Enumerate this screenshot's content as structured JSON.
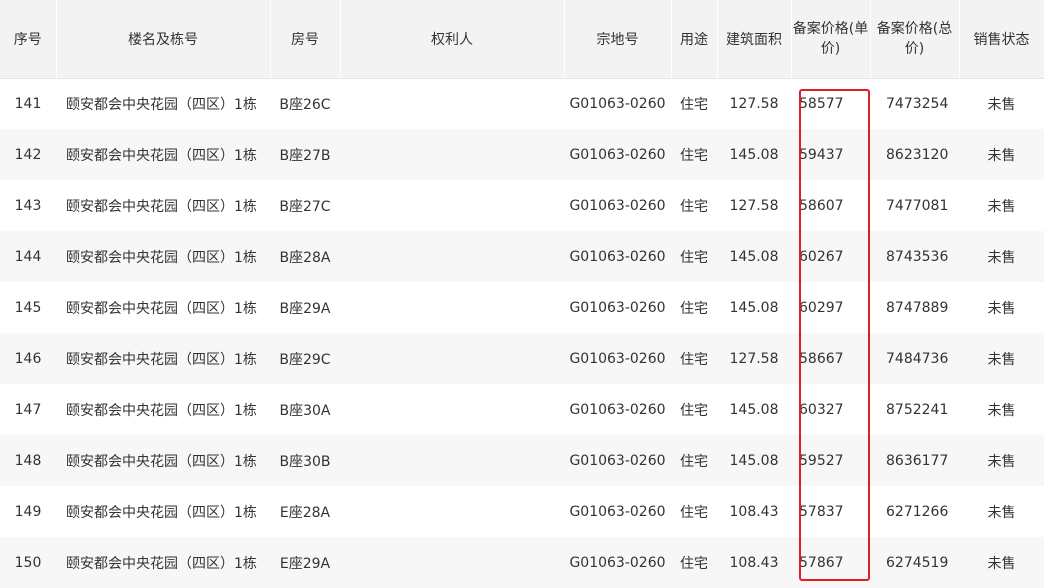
{
  "table": {
    "headers": {
      "index": "序号",
      "building": "楼名及栋号",
      "room": "房号",
      "owner": "权利人",
      "parcel": "宗地号",
      "usage": "用途",
      "area": "建筑面积",
      "unit_price": "备案价格(单价)",
      "total_price": "备案价格(总价)",
      "status": "销售状态"
    },
    "rows": [
      {
        "index": "141",
        "building": "颐安都会中央花园（四区）1栋",
        "room": "B座26C",
        "owner": "",
        "parcel": "G01063-0260",
        "usage": "住宅",
        "area": "127.58",
        "unit_price": "58577",
        "total_price": "7473254",
        "status": "未售"
      },
      {
        "index": "142",
        "building": "颐安都会中央花园（四区）1栋",
        "room": "B座27B",
        "owner": "",
        "parcel": "G01063-0260",
        "usage": "住宅",
        "area": "145.08",
        "unit_price": "59437",
        "total_price": "8623120",
        "status": "未售"
      },
      {
        "index": "143",
        "building": "颐安都会中央花园（四区）1栋",
        "room": "B座27C",
        "owner": "",
        "parcel": "G01063-0260",
        "usage": "住宅",
        "area": "127.58",
        "unit_price": "58607",
        "total_price": "7477081",
        "status": "未售"
      },
      {
        "index": "144",
        "building": "颐安都会中央花园（四区）1栋",
        "room": "B座28A",
        "owner": "",
        "parcel": "G01063-0260",
        "usage": "住宅",
        "area": "145.08",
        "unit_price": "60267",
        "total_price": "8743536",
        "status": "未售"
      },
      {
        "index": "145",
        "building": "颐安都会中央花园（四区）1栋",
        "room": "B座29A",
        "owner": "",
        "parcel": "G01063-0260",
        "usage": "住宅",
        "area": "145.08",
        "unit_price": "60297",
        "total_price": "8747889",
        "status": "未售"
      },
      {
        "index": "146",
        "building": "颐安都会中央花园（四区）1栋",
        "room": "B座29C",
        "owner": "",
        "parcel": "G01063-0260",
        "usage": "住宅",
        "area": "127.58",
        "unit_price": "58667",
        "total_price": "7484736",
        "status": "未售"
      },
      {
        "index": "147",
        "building": "颐安都会中央花园（四区）1栋",
        "room": "B座30A",
        "owner": "",
        "parcel": "G01063-0260",
        "usage": "住宅",
        "area": "145.08",
        "unit_price": "60327",
        "total_price": "8752241",
        "status": "未售"
      },
      {
        "index": "148",
        "building": "颐安都会中央花园（四区）1栋",
        "room": "B座30B",
        "owner": "",
        "parcel": "G01063-0260",
        "usage": "住宅",
        "area": "145.08",
        "unit_price": "59527",
        "total_price": "8636177",
        "status": "未售"
      },
      {
        "index": "149",
        "building": "颐安都会中央花园（四区）1栋",
        "room": "E座28A",
        "owner": "",
        "parcel": "G01063-0260",
        "usage": "住宅",
        "area": "108.43",
        "unit_price": "57837",
        "total_price": "6271266",
        "status": "未售"
      },
      {
        "index": "150",
        "building": "颐安都会中央花园（四区）1栋",
        "room": "E座29A",
        "owner": "",
        "parcel": "G01063-0260",
        "usage": "住宅",
        "area": "108.43",
        "unit_price": "57867",
        "total_price": "6274519",
        "status": "未售"
      }
    ]
  },
  "colors": {
    "header_bg": "#f3f3f3",
    "row_alt_bg": "#f7f7f7",
    "text": "#333333",
    "highlight_border": "#e02020"
  }
}
